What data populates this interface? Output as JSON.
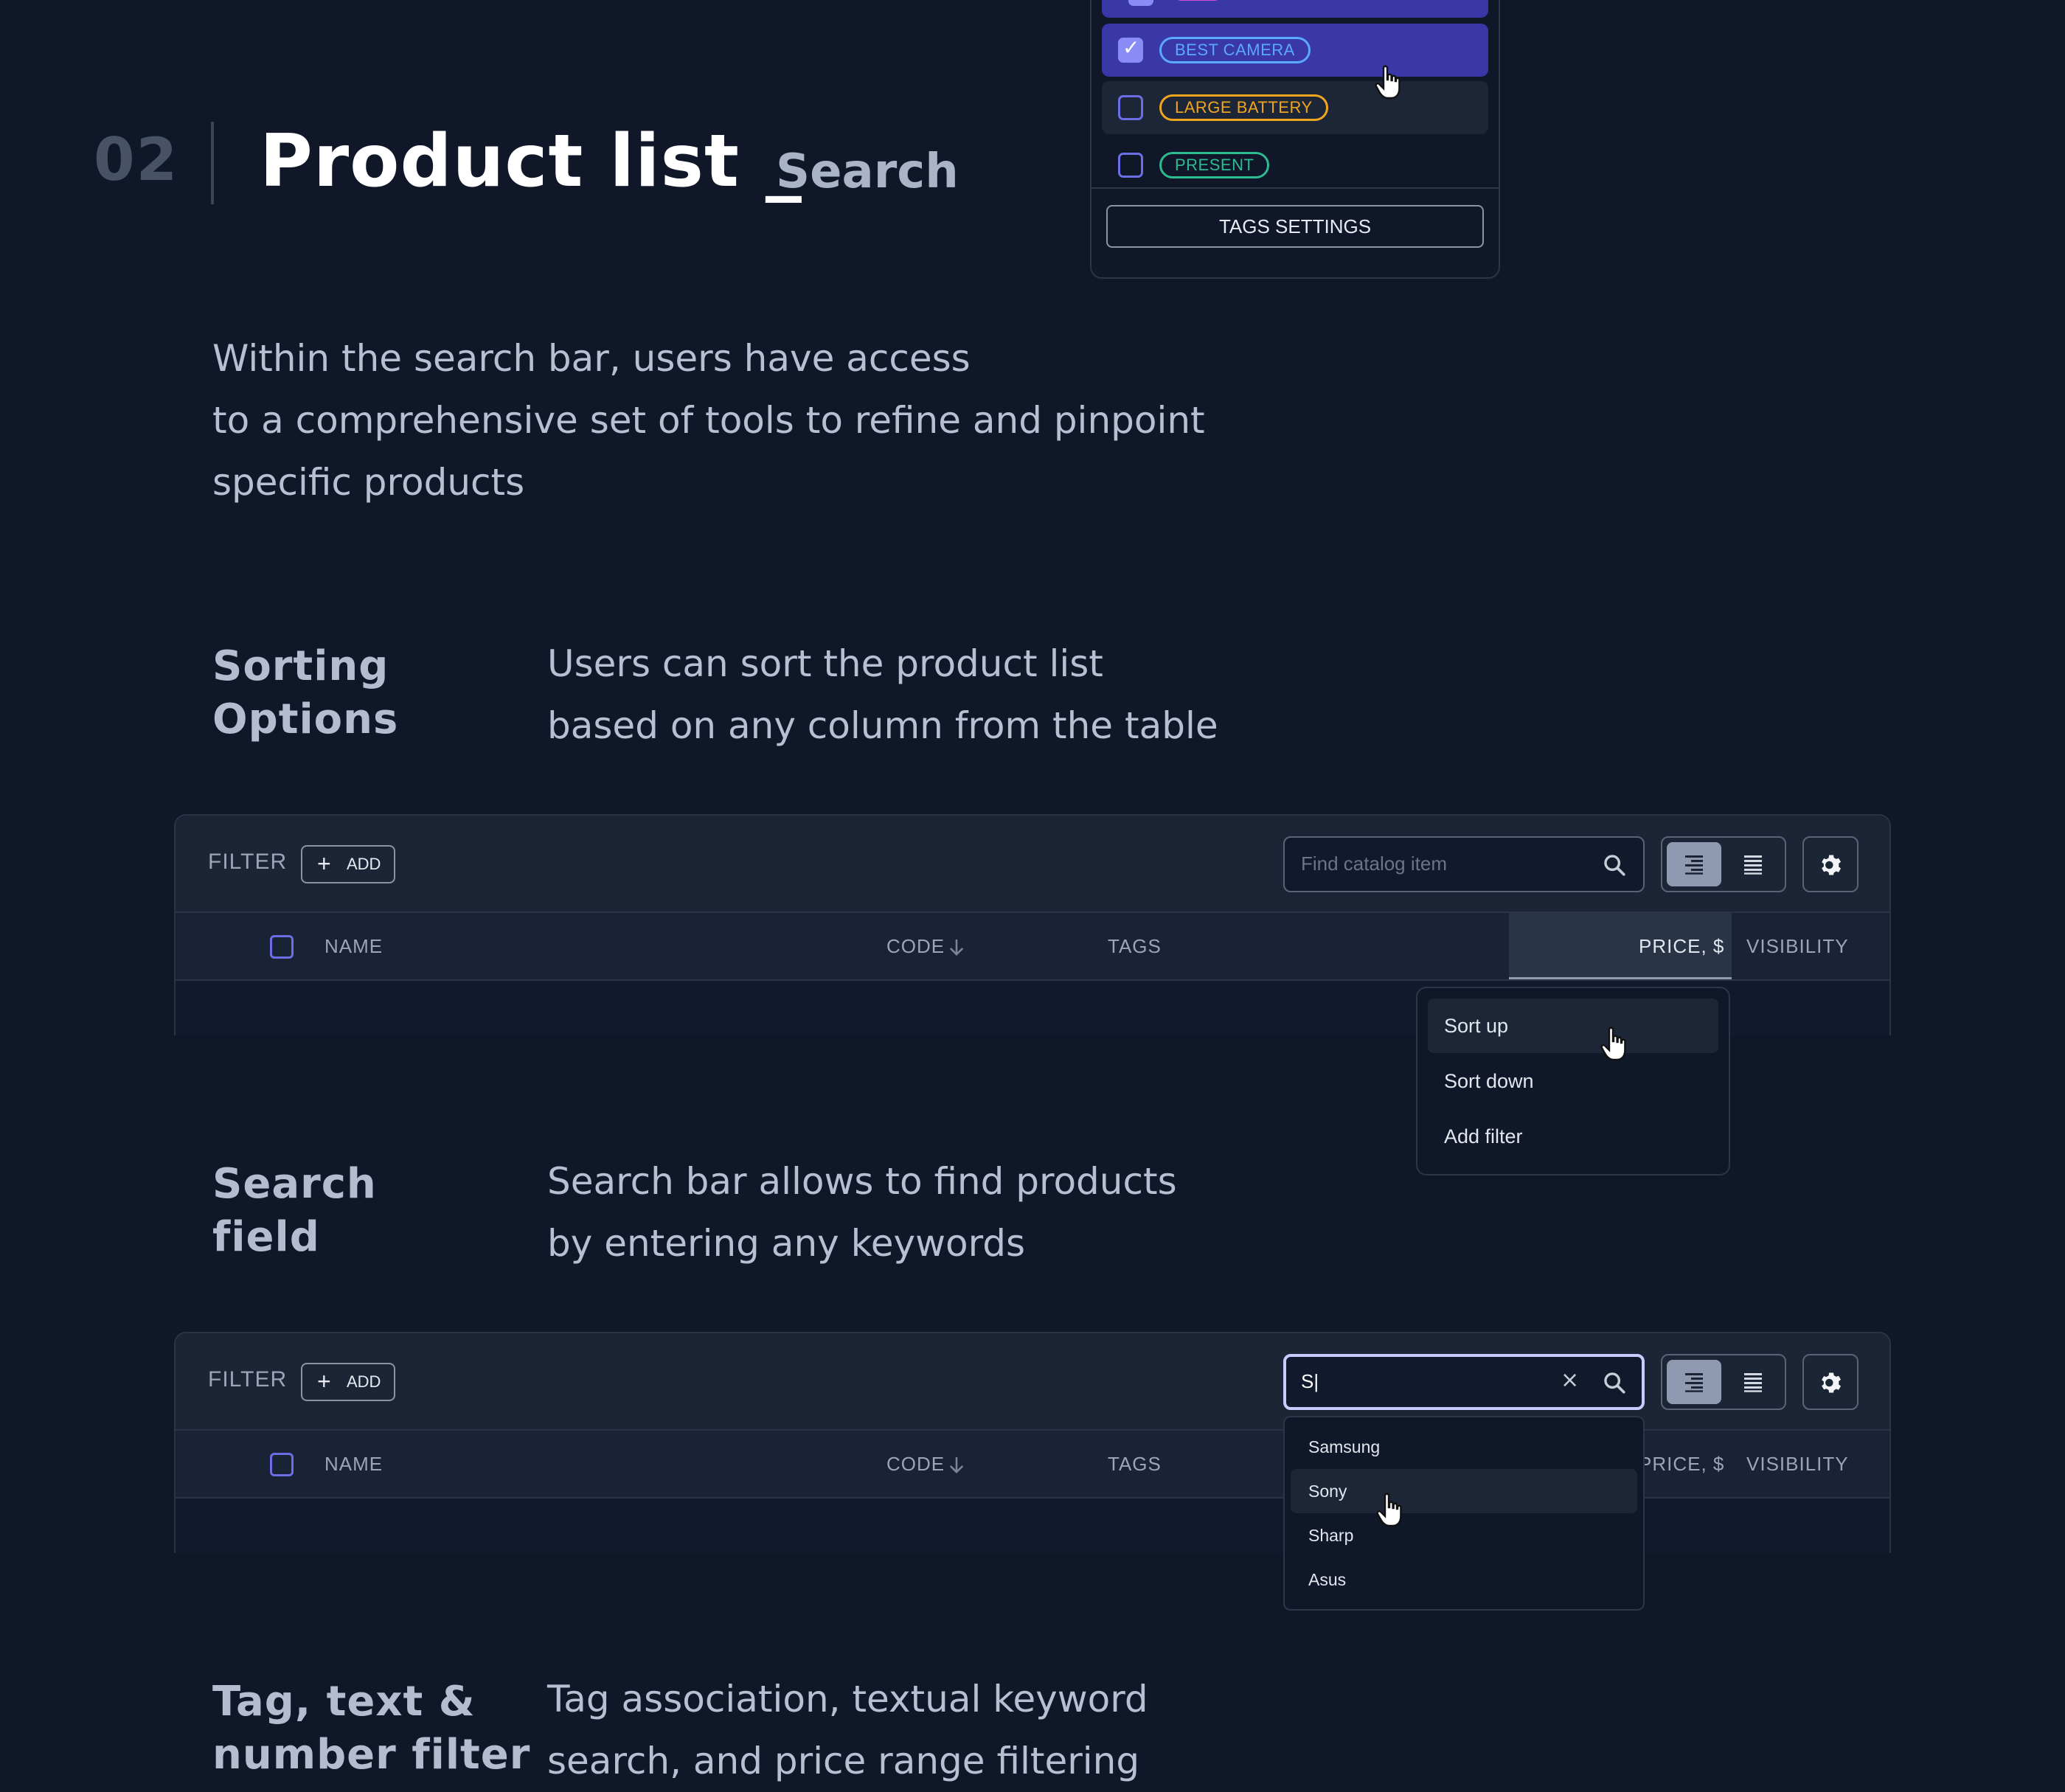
{
  "header": {
    "number": "02",
    "title": "Product list _",
    "subtitle": "Search"
  },
  "intro": {
    "lines": [
      "Within the search bar, users have access",
      "to a comprehensive set of tools to refine and pinpoint",
      "specific products"
    ]
  },
  "tag_dropdown": {
    "items": [
      {
        "label": "BEST CAMERA",
        "checked": true,
        "color": "#5aa8ff"
      },
      {
        "label": "LARGE BATTERY",
        "checked": false,
        "color": "#f0a51e"
      },
      {
        "label": "PRESENT",
        "checked": false,
        "color": "#2dbb91"
      }
    ],
    "settings_label": "TAGS SETTINGS"
  },
  "sections": {
    "sorting": {
      "heading_line1": "Sorting",
      "heading_line2": "Options",
      "desc_line1": "Users can sort the product list",
      "desc_line2": "based on any column from the table"
    },
    "search": {
      "heading_line1": "Search",
      "heading_line2": "field",
      "desc_line1": "Search bar allows to find products",
      "desc_line2": "by entering any keywords"
    },
    "tag_filter": {
      "heading_line1": "Tag, text &",
      "heading_line2": "number filter",
      "desc_line1": "Tag association, textual keyword",
      "desc_line2": "search, and price range filtering"
    }
  },
  "table1": {
    "filter_label": "FILTER",
    "add_label": "ADD",
    "search_placeholder": "Find catalog item",
    "columns": {
      "name": "NAME",
      "code": "CODE",
      "tags": "TAGS",
      "price": "PRICE, $",
      "visibility": "VISIBILITY"
    }
  },
  "sort_menu": {
    "items": [
      "Sort up",
      "Sort down",
      "Add filter"
    ]
  },
  "table2": {
    "filter_label": "FILTER",
    "add_label": "ADD",
    "search_value": "S|",
    "columns": {
      "name": "NAME",
      "code": "CODE",
      "tags": "TAGS",
      "price": "PRICE, $",
      "visibility": "VISIBILITY"
    }
  },
  "autocomplete": {
    "items": [
      "Samsung",
      "Sony",
      "Sharp",
      "Asus"
    ]
  },
  "icons": {
    "search": "search-icon",
    "clear": "close-icon",
    "gear": "gear-icon",
    "view_compact": "align-right-icon",
    "view_list": "list-icon",
    "sort_arrow": "arrow-down-icon",
    "cursor": "hand-pointer-icon"
  },
  "colors": {
    "background": "#0f1729",
    "accent": "#6c6ee6",
    "selected_row": "#3a37a7"
  }
}
